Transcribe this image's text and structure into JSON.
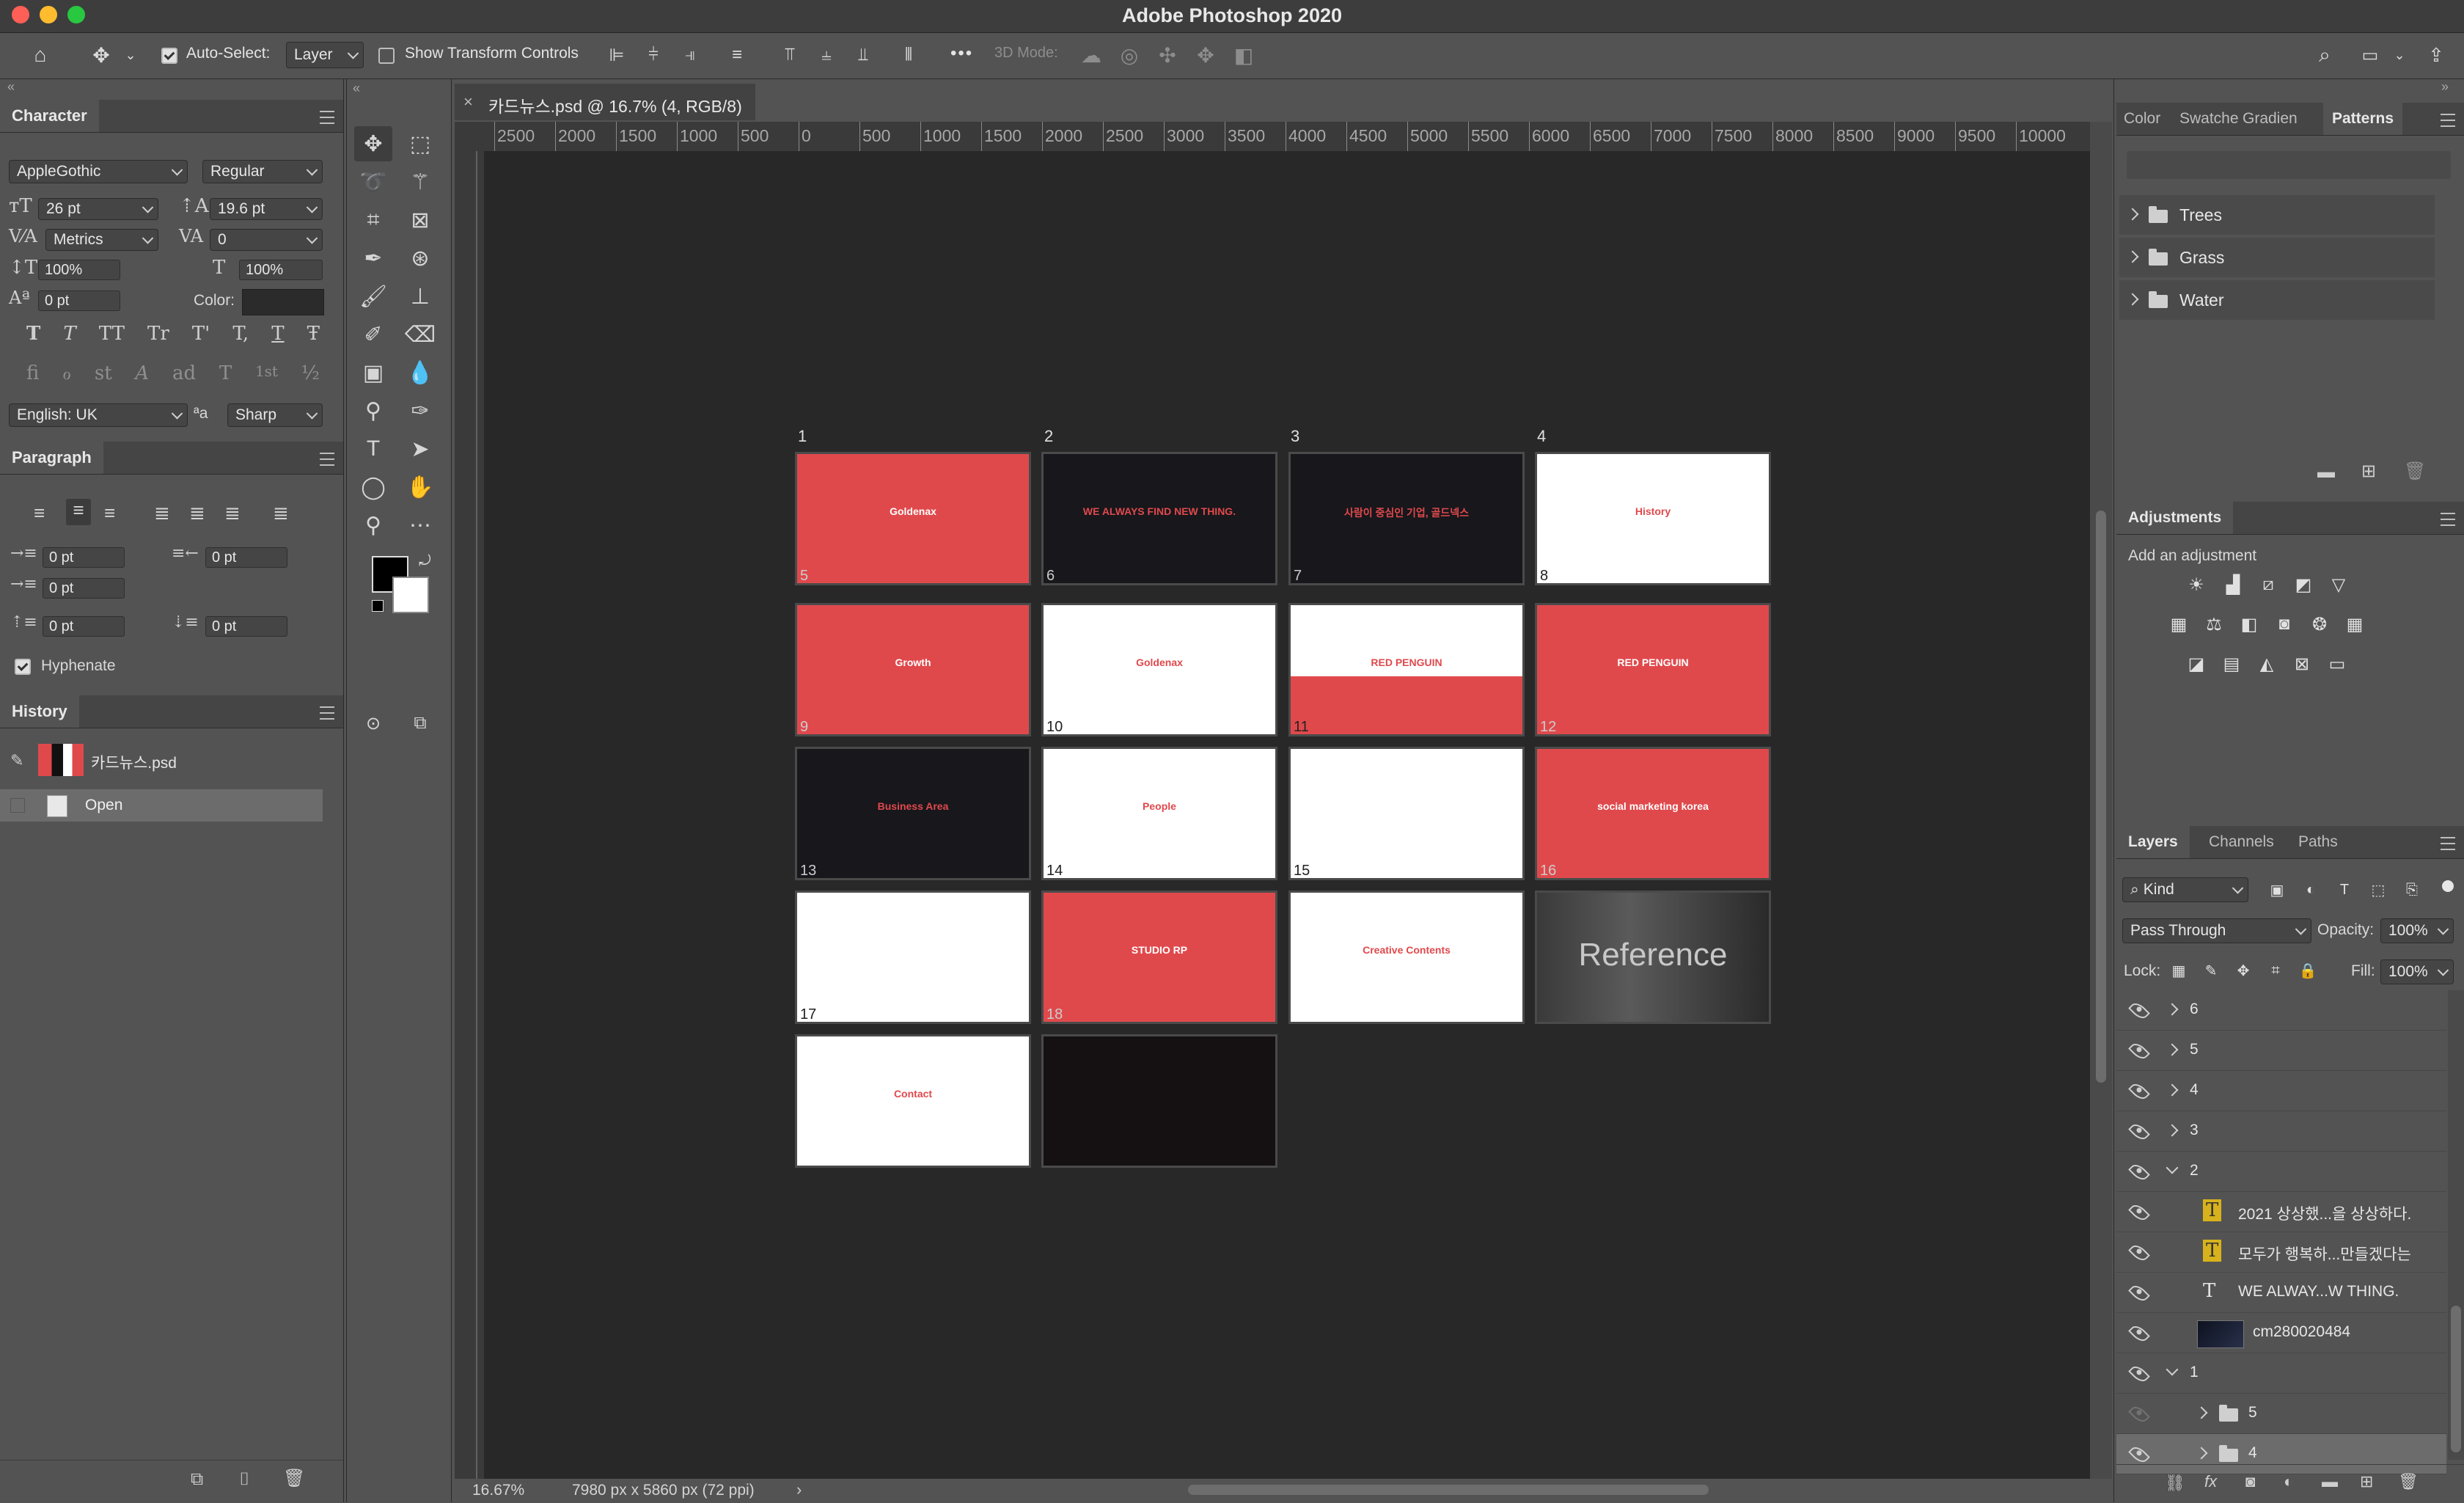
{
  "app": {
    "title": "Adobe Photoshop 2020"
  },
  "options": {
    "auto_select_label": "Auto-Select:",
    "auto_select_value": "Layer",
    "show_transform_label": "Show Transform Controls",
    "mode_3d_label": "3D Mode:",
    "more": "•••"
  },
  "character": {
    "tab": "Character",
    "font_family": "AppleGothic",
    "font_style": "Regular",
    "font_size": "26 pt",
    "leading": "19.6 pt",
    "kerning": "Metrics",
    "tracking": "0",
    "vert_scale": "100%",
    "horiz_scale": "100%",
    "baseline": "0 pt",
    "color_label": "Color:",
    "language": "English: UK",
    "aa_label": "ªa",
    "antialias": "Sharp",
    "type_buttons": [
      "T",
      "T",
      "TT",
      "Tr",
      "T'",
      "T,",
      "T",
      "Ŧ"
    ],
    "ot_buttons": [
      "fi",
      "ℴ",
      "st",
      "A",
      "ad",
      "T",
      "1st",
      "½"
    ]
  },
  "paragraph": {
    "tab": "Paragraph",
    "indent_left": "0 pt",
    "indent_right": "0 pt",
    "indent_first": "0 pt",
    "space_before": "0 pt",
    "space_after": "0 pt",
    "hyphenate_label": "Hyphenate"
  },
  "history": {
    "tab": "History",
    "snapshot": "카드뉴스.psd",
    "items": [
      {
        "label": "Open"
      }
    ]
  },
  "document": {
    "tab_title": "카드뉴스.psd @ 16.7% (4, RGB/8)",
    "ruler_h": [
      "2500",
      "2000",
      "1500",
      "1000",
      "500",
      "0",
      "500",
      "1000",
      "1500",
      "2000",
      "2500",
      "3000",
      "3500",
      "4000",
      "4500",
      "5000",
      "5500",
      "6000",
      "6500",
      "7000",
      "7500",
      "8000",
      "8500",
      "9000",
      "9500",
      "10000"
    ],
    "zoom": "16.67%",
    "dimensions": "7980 px x 5860 px (72 ppi)",
    "artboard_labels": [
      "1",
      "2",
      "3",
      "4"
    ],
    "slides": [
      {
        "num": "5",
        "label": "Goldenax",
        "style": "red"
      },
      {
        "num": "6",
        "label": "WE ALWAYS FIND NEW THING.",
        "style": "dark"
      },
      {
        "num": "7",
        "label": "사람이 중심인 기업, 골드넥스",
        "style": "dark"
      },
      {
        "num": "8",
        "label": "History",
        "style": "white"
      },
      {
        "num": "9",
        "label": "Growth",
        "style": "red"
      },
      {
        "num": "10",
        "label": "Goldenax",
        "style": "white"
      },
      {
        "num": "11",
        "label": "RED PENGUIN",
        "style": "split"
      },
      {
        "num": "12",
        "label": "RED PENGUIN",
        "style": "red"
      },
      {
        "num": "13",
        "label": "Business Area",
        "style": "dark"
      },
      {
        "num": "14",
        "label": "People",
        "style": "white"
      },
      {
        "num": "15",
        "label": "",
        "style": "white"
      },
      {
        "num": "16",
        "label": "social marketing korea",
        "style": "red"
      },
      {
        "num": "17",
        "label": "",
        "style": "white"
      },
      {
        "num": "18",
        "label": "STUDIO RP",
        "style": "red"
      },
      {
        "num": "",
        "label": "Creative Contents",
        "style": "white"
      },
      {
        "num": "",
        "label": "Reference",
        "style": "photo"
      },
      {
        "num": "",
        "label": "Contact",
        "style": "white"
      },
      {
        "num": "",
        "label": "",
        "style": "black"
      }
    ]
  },
  "right_tabs": {
    "swatch_tabs": [
      "Color",
      "Swatche",
      "Gradien",
      "Patterns"
    ],
    "patterns": [
      {
        "label": "Trees"
      },
      {
        "label": "Grass"
      },
      {
        "label": "Water"
      }
    ],
    "adjustments_tab": "Adjustments",
    "add_adjustment": "Add an adjustment"
  },
  "layers": {
    "tabs": [
      "Layers",
      "Channels",
      "Paths"
    ],
    "kind": "Kind",
    "blend": "Pass Through",
    "opacity_label": "Opacity:",
    "opacity": "100%",
    "lock_label": "Lock:",
    "fill_label": "Fill:",
    "fill": "100%",
    "rows": [
      {
        "name": "6",
        "type": "group",
        "indent": 0
      },
      {
        "name": "5",
        "type": "group",
        "indent": 0
      },
      {
        "name": "4",
        "type": "group",
        "indent": 0
      },
      {
        "name": "3",
        "type": "group",
        "indent": 0
      },
      {
        "name": "2",
        "type": "group-open",
        "indent": 0
      },
      {
        "name": "2021 상상했...을 상상하다.",
        "type": "text-warn",
        "indent": 1
      },
      {
        "name": "모두가 행복하...만들겠다는",
        "type": "text-warn",
        "indent": 1
      },
      {
        "name": "WE ALWAY...W THING.",
        "type": "text",
        "indent": 1
      },
      {
        "name": "cm280020484",
        "type": "image",
        "indent": 1
      },
      {
        "name": "1",
        "type": "group-open",
        "indent": 0
      },
      {
        "name": "5",
        "type": "folder",
        "indent": 1
      },
      {
        "name": "4",
        "type": "folder",
        "indent": 1
      }
    ]
  },
  "colors": {
    "accent_red": "#e0494c",
    "panel_bg": "#535353",
    "canvas_bg": "#282828"
  }
}
